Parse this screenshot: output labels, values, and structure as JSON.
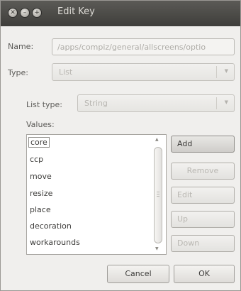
{
  "window": {
    "title": "Edit Key",
    "controls": {
      "close_glyph": "✕",
      "minimize_glyph": "–",
      "maximize_glyph": "+"
    }
  },
  "form": {
    "name_label": "Name:",
    "name_value": "/apps/compiz/general/allscreens/optio",
    "type_label": "Type:",
    "type_value": "List",
    "list_type_label": "List type:",
    "list_type_value": "String",
    "values_label": "Values:"
  },
  "values": [
    "core",
    "ccp",
    "move",
    "resize",
    "place",
    "decoration",
    "workarounds"
  ],
  "selected_index": 0,
  "buttons": {
    "add": "Add",
    "remove": "Remove",
    "edit": "Edit",
    "up": "Up",
    "down": "Down",
    "cancel": "Cancel",
    "ok": "OK"
  },
  "colors": {
    "titlebar": "#4a4946",
    "window_bg": "#f0efed",
    "active_button": "#dcdad7"
  }
}
